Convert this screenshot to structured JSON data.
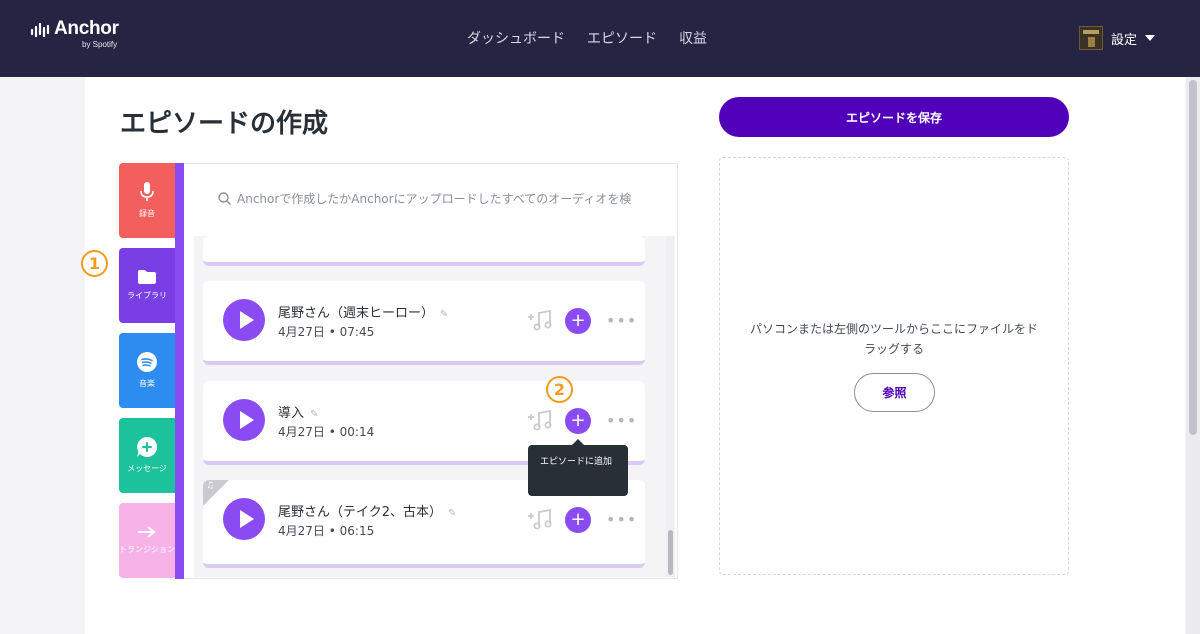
{
  "header": {
    "logo_text": "Anchor",
    "logo_sub": "by Spotify",
    "nav": [
      "ダッシュボード",
      "エピソード",
      "収益"
    ],
    "account_label": "設定"
  },
  "page_title": "エピソードの作成",
  "tools": {
    "record": "録音",
    "library": "ライブラリ",
    "music": "音楽",
    "messages": "メッセージ",
    "transitions": "トランジション"
  },
  "annotations": {
    "badge1": "1",
    "badge2": "2"
  },
  "search": {
    "placeholder": "Anchorで作成したかAnchorにアップロードしたすべてのオーディオを検"
  },
  "episodes": [
    {
      "title": "尾野さん（週末ヒーロー）",
      "date": "4月27日",
      "duration": "07:45"
    },
    {
      "title": "導入",
      "date": "4月27日",
      "duration": "00:14"
    },
    {
      "title": "尾野さん（テイク2、古本）",
      "date": "4月27日",
      "duration": "06:15"
    }
  ],
  "tooltip": "エピソードに追加",
  "save_button": "エピソードを保存",
  "dropzone": {
    "text": "パソコンまたは左側のツールからここにファイルをドラッグする",
    "browse": "参照"
  },
  "colors": {
    "header_bg": "#262443",
    "accent_purple": "#8a4cf2",
    "save_purple": "#5000b9",
    "badge_orange": "#f49a1c"
  }
}
